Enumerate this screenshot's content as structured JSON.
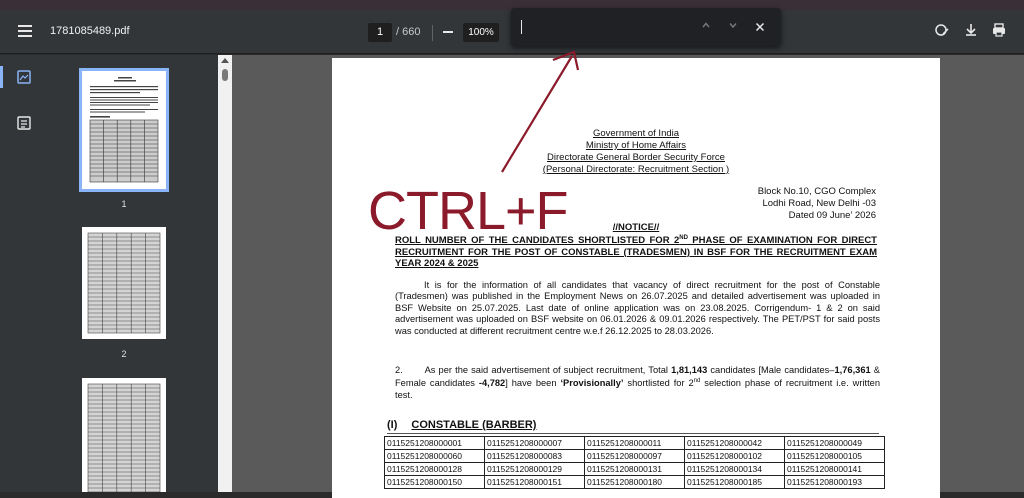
{
  "toolbar": {
    "file_name": "1781085489.pdf",
    "current_page": "1",
    "total_pages": "/ 660",
    "zoom": "100%"
  },
  "find_bar": {
    "value": "",
    "placeholder": ""
  },
  "thumbnails": [
    {
      "label": "1"
    },
    {
      "label": "2"
    }
  ],
  "annotation": {
    "text": "CTRL+F"
  },
  "document": {
    "header_lines": [
      "Government of India",
      "Ministry of Home Affairs",
      "Directorate General Border Security Force",
      "(Personal Directorate: Recruitment Section )"
    ],
    "address_lines": [
      "Block No.10, CGO Complex",
      "Lodhi Road, New Delhi -03",
      "Dated 09 June’ 2026"
    ],
    "notice": "//NOTICE//",
    "title_pre": "ROLL NUMBER OF THE CANDIDATES SHORTLISTED FOR 2",
    "title_sup": "ND",
    "title_post": " PHASE OF EXAMINATION FOR DIRECT RECRUITMENT FOR THE POST OF CONSTABLE (TRADESMEN) IN BSF FOR THE RECRUITMENT EXAM YEAR 2024 & 2025",
    "para1": "It is for the information of all candidates that vacancy of direct recruitment for the post of Constable (Tradesmen) was published in the Employment News on 26.07.2025 and detailed advertisement was uploaded in BSF Website on 25.07.2025. Last date of online application was on 23.08.2025. Corrigendum- 1 & 2 on said advertisement was uploaded on BSF website on 06.01.2026 & 09.01.2026 respectively. The PET/PST for said posts was conducted at different recruitment centre w.e.f 26.12.2025 to 28.03.2026.",
    "para2": {
      "num": "2.",
      "t1": "As per the said advertisement of subject recruitment, Total ",
      "total": "1,81,143",
      "t2": " candidates [Male  candidates–",
      "male": "1,76,361",
      "t3": " & Female candidates ",
      "female": "-4,782",
      "t4": "] have been ",
      "prov": "‘Provisionally’",
      "t5": "  shortlisted for 2",
      "sup": "nd",
      "t6": " selection phase of recruitment i.e. written test."
    },
    "section_num": "(I)",
    "section_title": "CONSTABLE (BARBER)",
    "rows": [
      [
        "0115251208000001",
        "0115251208000007",
        "0115251208000011",
        "0115251208000042",
        "0115251208000049"
      ],
      [
        "0115251208000060",
        "0115251208000083",
        "0115251208000097",
        "0115251208000102",
        "0115251208000105"
      ],
      [
        "0115251208000128",
        "0115251208000129",
        "0115251208000131",
        "0115251208000134",
        "0115251208000141"
      ],
      [
        "0115251208000150",
        "0115251208000151",
        "0115251208000180",
        "0115251208000185",
        "0115251208000193"
      ]
    ]
  }
}
